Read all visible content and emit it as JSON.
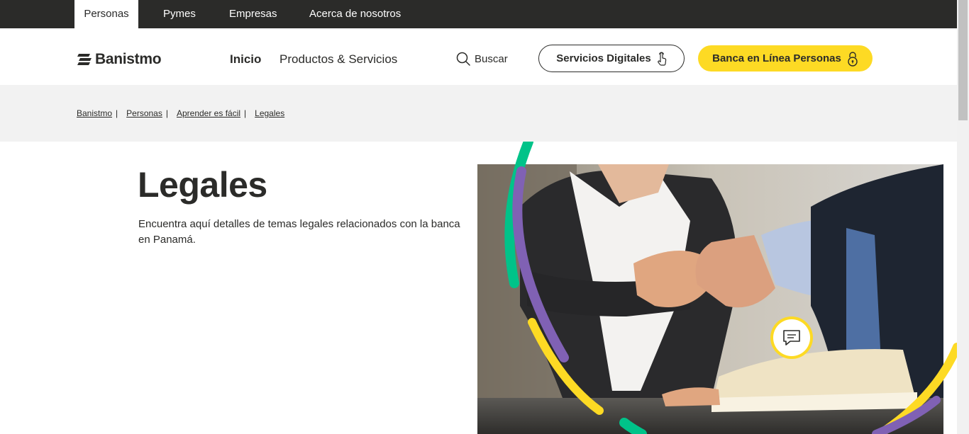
{
  "topbar": {
    "segments": [
      "Personas",
      "Pymes",
      "Empresas",
      "Acerca de nosotros"
    ]
  },
  "header": {
    "logo_text": "Banistmo",
    "nav": [
      "Inicio",
      "Productos & Servicios"
    ],
    "search_label": "Buscar",
    "digital_services_label": "Servicios Digitales",
    "online_banking_label": "Banca en Línea Personas"
  },
  "breadcrumb": [
    "Banistmo",
    "Personas",
    "Aprender es fácil",
    "Legales"
  ],
  "main": {
    "title": "Legales",
    "description": "Encuentra aquí detalles de temas legales relacionados con la banca en Panamá."
  },
  "colors": {
    "brand_yellow": "#fdda24",
    "dark": "#2b2b29",
    "green": "#00c389",
    "purple": "#8061b4",
    "light_gray": "#f2f2f2"
  },
  "icons": {
    "search": "search-icon",
    "touch": "touch-icon",
    "lock": "lock-icon",
    "chat": "chat-icon"
  }
}
